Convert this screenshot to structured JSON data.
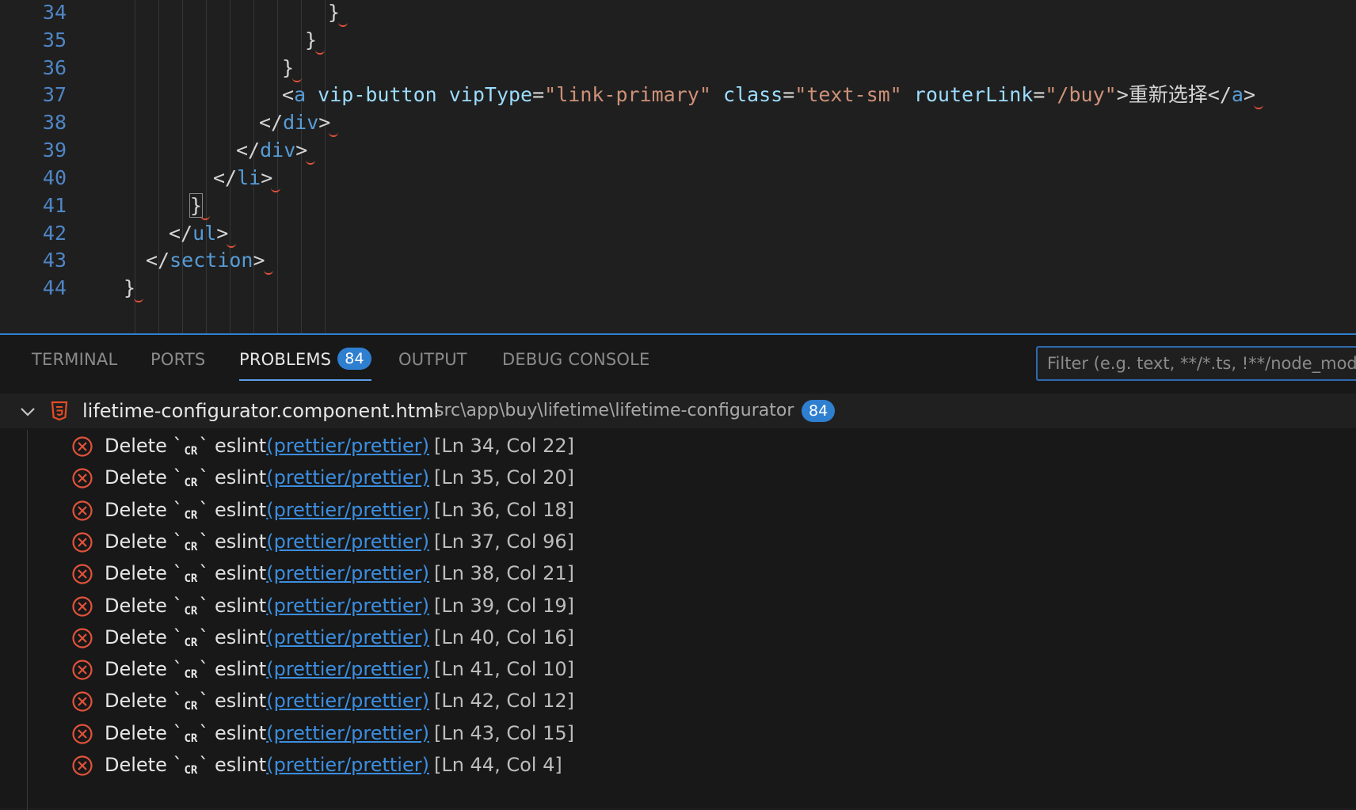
{
  "editor": {
    "lines": [
      {
        "no": "34",
        "tokens": [
          {
            "t": "}",
            "c": "punc"
          }
        ]
      },
      {
        "no": "35",
        "tokens": [
          {
            "t": "}",
            "c": "punc"
          }
        ]
      },
      {
        "no": "36",
        "tokens": [
          {
            "t": "}",
            "c": "punc"
          }
        ]
      },
      {
        "no": "37",
        "tokens": [
          {
            "t": "<",
            "c": "punc"
          },
          {
            "t": "a",
            "c": "tag"
          },
          {
            "t": " vip-button vipType",
            "c": "attr"
          },
          {
            "t": "=",
            "c": "punc"
          },
          {
            "t": "\"link-primary\"",
            "c": "str"
          },
          {
            "t": " class",
            "c": "attr"
          },
          {
            "t": "=",
            "c": "punc"
          },
          {
            "t": "\"text-sm\"",
            "c": "str"
          },
          {
            "t": " routerLink",
            "c": "attr"
          },
          {
            "t": "=",
            "c": "punc"
          },
          {
            "t": "\"/buy\"",
            "c": "str"
          },
          {
            "t": ">",
            "c": "punc"
          },
          {
            "t": "重新选择",
            "c": "text"
          },
          {
            "t": "</",
            "c": "punc"
          },
          {
            "t": "a",
            "c": "tag"
          },
          {
            "t": ">",
            "c": "punc"
          }
        ]
      },
      {
        "no": "38",
        "tokens": [
          {
            "t": "</",
            "c": "punc"
          },
          {
            "t": "div",
            "c": "tag"
          },
          {
            "t": ">",
            "c": "punc"
          }
        ]
      },
      {
        "no": "39",
        "tokens": [
          {
            "t": "</",
            "c": "punc"
          },
          {
            "t": "div",
            "c": "tag"
          },
          {
            "t": ">",
            "c": "punc"
          }
        ]
      },
      {
        "no": "40",
        "tokens": [
          {
            "t": "</",
            "c": "punc"
          },
          {
            "t": "li",
            "c": "tag"
          },
          {
            "t": ">",
            "c": "punc"
          }
        ]
      },
      {
        "no": "41",
        "tokens": [
          {
            "t": "}",
            "c": "punc"
          }
        ]
      },
      {
        "no": "42",
        "tokens": [
          {
            "t": "</",
            "c": "punc"
          },
          {
            "t": "ul",
            "c": "tag"
          },
          {
            "t": ">",
            "c": "punc"
          }
        ]
      },
      {
        "no": "43",
        "tokens": [
          {
            "t": "</",
            "c": "punc"
          },
          {
            "t": "section",
            "c": "tag"
          },
          {
            "t": ">",
            "c": "punc"
          }
        ]
      },
      {
        "no": "44",
        "tokens": [
          {
            "t": "}",
            "c": "punc"
          }
        ]
      }
    ]
  },
  "panel": {
    "tabs": {
      "terminal": "TERMINAL",
      "ports": "PORTS",
      "problems": "PROBLEMS",
      "problems_count": "84",
      "output": "OUTPUT",
      "debug_console": "DEBUG CONSOLE"
    },
    "filter_placeholder": "Filter (e.g. text, **/*.ts, !**/node_modules/**)",
    "file": {
      "name": "lifetime-configurator.component.html",
      "path": "src\\app\\buy\\lifetime\\lifetime-configurator",
      "count": "84",
      "icon": "html5-icon"
    },
    "problems": [
      {
        "message": "Delete `",
        "cr": "CR",
        "tail": "`",
        "source": "eslint",
        "code": "(prettier/prettier)",
        "location": "[Ln 34, Col 22]"
      },
      {
        "message": "Delete `",
        "cr": "CR",
        "tail": "`",
        "source": "eslint",
        "code": "(prettier/prettier)",
        "location": "[Ln 35, Col 20]"
      },
      {
        "message": "Delete `",
        "cr": "CR",
        "tail": "`",
        "source": "eslint",
        "code": "(prettier/prettier)",
        "location": "[Ln 36, Col 18]"
      },
      {
        "message": "Delete `",
        "cr": "CR",
        "tail": "`",
        "source": "eslint",
        "code": "(prettier/prettier)",
        "location": "[Ln 37, Col 96]"
      },
      {
        "message": "Delete `",
        "cr": "CR",
        "tail": "`",
        "source": "eslint",
        "code": "(prettier/prettier)",
        "location": "[Ln 38, Col 21]"
      },
      {
        "message": "Delete `",
        "cr": "CR",
        "tail": "`",
        "source": "eslint",
        "code": "(prettier/prettier)",
        "location": "[Ln 39, Col 19]"
      },
      {
        "message": "Delete `",
        "cr": "CR",
        "tail": "`",
        "source": "eslint",
        "code": "(prettier/prettier)",
        "location": "[Ln 40, Col 16]"
      },
      {
        "message": "Delete `",
        "cr": "CR",
        "tail": "`",
        "source": "eslint",
        "code": "(prettier/prettier)",
        "location": "[Ln 41, Col 10]"
      },
      {
        "message": "Delete `",
        "cr": "CR",
        "tail": "`",
        "source": "eslint",
        "code": "(prettier/prettier)",
        "location": "[Ln 42, Col 12]"
      },
      {
        "message": "Delete `",
        "cr": "CR",
        "tail": "`",
        "source": "eslint",
        "code": "(prettier/prettier)",
        "location": "[Ln 43, Col 15]"
      },
      {
        "message": "Delete `",
        "cr": "CR",
        "tail": "`",
        "source": "eslint",
        "code": "(prettier/prettier)",
        "location": "[Ln 44, Col 4]"
      }
    ]
  },
  "colors": {
    "accent": "#2f7fd0",
    "error": "#e0533a",
    "link": "#3c8ee0",
    "line_number": "#4f86c6"
  }
}
